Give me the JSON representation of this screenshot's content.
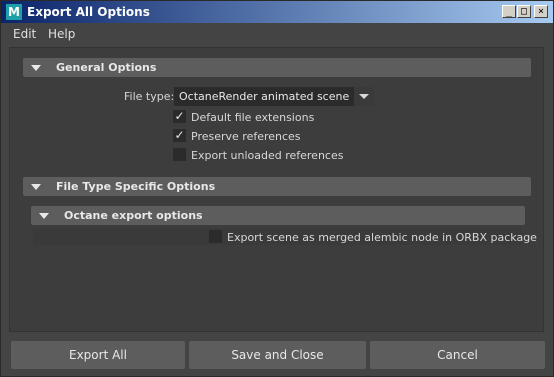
{
  "window": {
    "title": "Export All Options",
    "app_icon_letter": "M",
    "controls": {
      "minimize": "_",
      "maximize": "□",
      "close": "×"
    }
  },
  "menu": {
    "items": [
      "Edit",
      "Help"
    ]
  },
  "general_options": {
    "label": "General Options",
    "file_type_label": "File type:",
    "file_type_value": "OctaneRender animated scene",
    "checkboxes": [
      {
        "label": "Default file extensions",
        "checked": true
      },
      {
        "label": "Preserve references",
        "checked": true
      },
      {
        "label": "Export unloaded references",
        "checked": false
      }
    ]
  },
  "file_type_specific": {
    "label": "File Type Specific Options",
    "octane": {
      "label": "Octane export options",
      "checkbox": {
        "label": "Export scene as merged alembic node in ORBX package",
        "checked": false
      }
    }
  },
  "buttons": {
    "export_all": "Export All",
    "save_and_close": "Save and Close",
    "cancel": "Cancel"
  },
  "check_glyph": "✓",
  "colors": {
    "titlebar_start": "#0a246a",
    "titlebar_end": "#a6caf0",
    "background": "#444444",
    "section_bar": "#5d5d5d"
  }
}
